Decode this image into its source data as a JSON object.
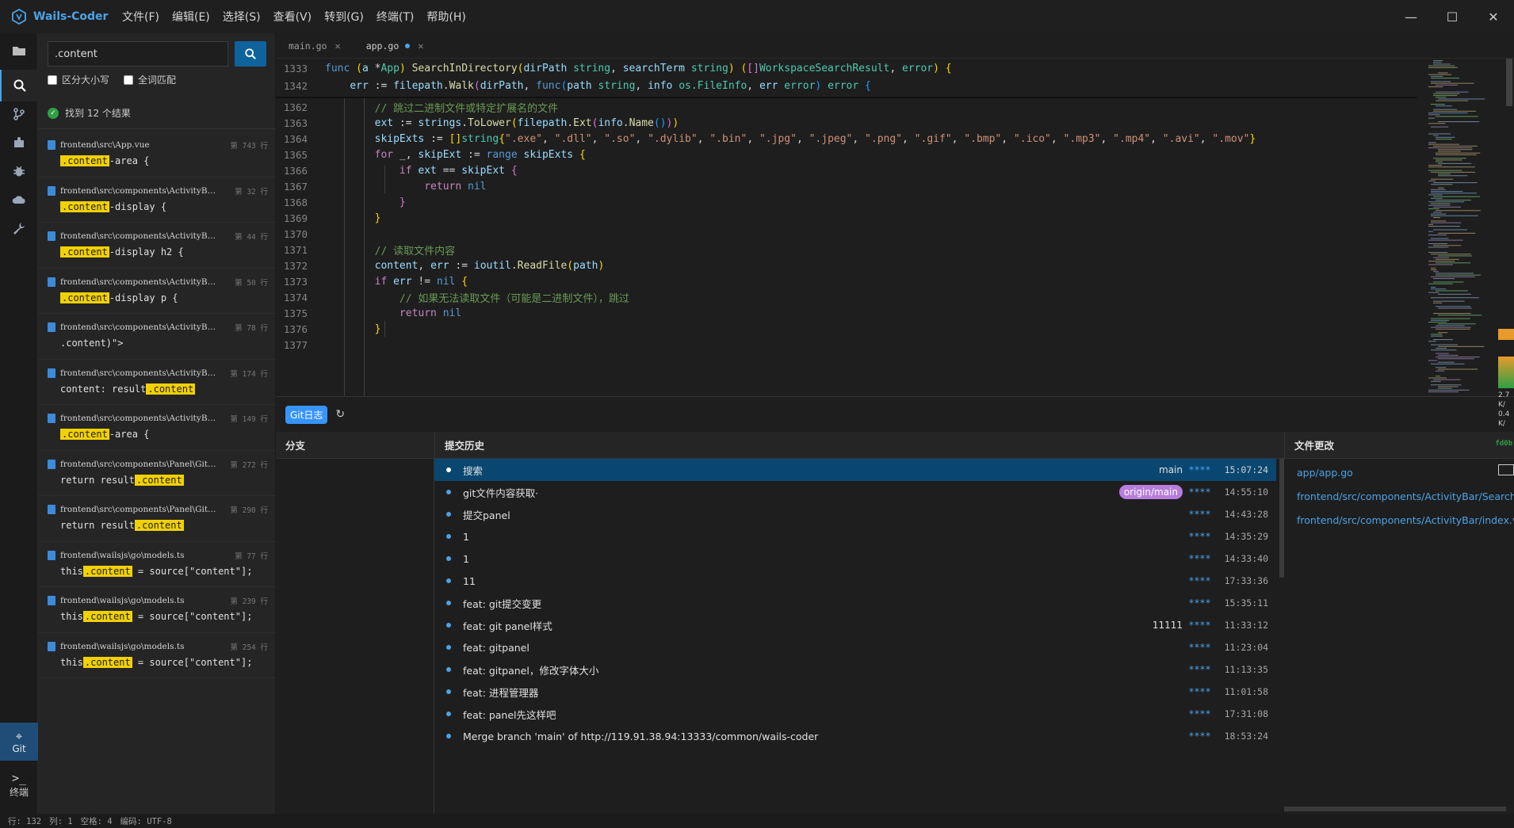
{
  "app": {
    "title": "Wails-Coder",
    "menus": [
      "文件(F)",
      "编辑(E)",
      "选择(S)",
      "查看(V)",
      "转到(G)",
      "终端(T)",
      "帮助(H)"
    ],
    "window_controls": [
      "—",
      "☐",
      "✕"
    ]
  },
  "activity": {
    "icons": [
      "folder-icon",
      "search-icon",
      "branch-icon",
      "puzzle-icon",
      "bug-icon",
      "cloud-icon",
      "wrench-icon"
    ],
    "git_label": "Git",
    "git_symbol": "⌖",
    "terminal_label": "终端",
    "terminal_symbol": ">_"
  },
  "search": {
    "value": ".content",
    "case_sensitive_label": "区分大小写",
    "whole_word_label": "全词匹配",
    "summary": "找到 12 个结果",
    "results": [
      {
        "path": "frontend\\src\\App.vue",
        "line": "第 743 行",
        "pre": "",
        "match": ".content",
        "post": "-area {"
      },
      {
        "path": "frontend\\src\\components\\ActivityBar\\…",
        "line": "第 32 行",
        "pre": "",
        "match": ".content",
        "post": "-display {"
      },
      {
        "path": "frontend\\src\\components\\ActivityBar\\…",
        "line": "第 44 行",
        "pre": "",
        "match": ".content",
        "post": "-display h2 {"
      },
      {
        "path": "frontend\\src\\components\\ActivityBar\\…",
        "line": "第 50 行",
        "pre": "",
        "match": ".content",
        "post": "-display p {"
      },
      {
        "path": "frontend\\src\\components\\ActivityBar\\…",
        "line": "第 78 行",
        "pre": ".content)\">",
        "match": "",
        "post": ""
      },
      {
        "path": "frontend\\src\\components\\ActivityBar\\…",
        "line": "第 174 行",
        "pre": "content: result",
        "match": ".content",
        "post": ""
      },
      {
        "path": "frontend\\src\\components\\ActivityBar\\…",
        "line": "第 149 行",
        "pre": "",
        "match": ".content",
        "post": "-area {"
      },
      {
        "path": "frontend\\src\\components\\Panel\\GitPanel…",
        "line": "第 272 行",
        "pre": "return result",
        "match": ".content",
        "post": ""
      },
      {
        "path": "frontend\\src\\components\\Panel\\GitPanel…",
        "line": "第 290 行",
        "pre": "return result",
        "match": ".content",
        "post": ""
      },
      {
        "path": "frontend\\wailsjs\\go\\models.ts",
        "line": "第 77 行",
        "pre": "this",
        "match": ".content",
        "post": " = source[\"content\"];"
      },
      {
        "path": "frontend\\wailsjs\\go\\models.ts",
        "line": "第 239 行",
        "pre": "this",
        "match": ".content",
        "post": " = source[\"content\"];"
      },
      {
        "path": "frontend\\wailsjs\\go\\models.ts",
        "line": "第 254 行",
        "pre": "this",
        "match": ".content",
        "post": " = source[\"content\"];"
      }
    ]
  },
  "editor": {
    "tabs": [
      {
        "label": "main.go",
        "modified": false
      },
      {
        "label": "app.go",
        "modified": true
      }
    ],
    "line_numbers": [
      "1333",
      "1342",
      "1362",
      "1363",
      "1364",
      "1365",
      "1366",
      "1367",
      "1368",
      "1369",
      "1370",
      "1371",
      "1372",
      "1373",
      "1374",
      "1375",
      "1376",
      "1377"
    ]
  },
  "git": {
    "panel_label": "Git日志",
    "refresh_icon": "↻",
    "branch_header": "分支",
    "commits_header": "提交历史",
    "files_header": "文件更改",
    "hash_hint": "fd0b",
    "commits": [
      {
        "message": "搜索",
        "ref": "main",
        "ref_pill": false,
        "author": "****",
        "time": "15:07:24"
      },
      {
        "message": "git文件内容获取·",
        "ref": "origin/main",
        "ref_pill": true,
        "author": "****",
        "time": "14:55:10"
      },
      {
        "message": "提交panel",
        "ref": "",
        "ref_pill": false,
        "author": "****",
        "time": "14:43:28"
      },
      {
        "message": "1",
        "ref": "",
        "ref_pill": false,
        "author": "****",
        "time": "14:35:29"
      },
      {
        "message": "1",
        "ref": "",
        "ref_pill": false,
        "author": "****",
        "time": "14:33:40"
      },
      {
        "message": "11",
        "ref": "",
        "ref_pill": false,
        "author": "****",
        "time": "17:33:36"
      },
      {
        "message": "feat: git提交变更",
        "ref": "",
        "ref_pill": false,
        "author": "****",
        "time": "15:35:11"
      },
      {
        "message": "feat: git panel样式",
        "ref": "11111",
        "ref_pill": false,
        "author": "****",
        "time": "11:33:12"
      },
      {
        "message": "feat: gitpanel",
        "ref": "",
        "ref_pill": false,
        "author": "****",
        "time": "11:23:04"
      },
      {
        "message": "feat: gitpanel，修改字体大小",
        "ref": "",
        "ref_pill": false,
        "author": "****",
        "time": "11:13:35"
      },
      {
        "message": "feat: 进程管理器",
        "ref": "",
        "ref_pill": false,
        "author": "****",
        "time": "11:01:58"
      },
      {
        "message": "feat: panel先这样吧",
        "ref": "",
        "ref_pill": false,
        "author": "****",
        "time": "17:31:08"
      },
      {
        "message": "Merge branch 'main' of http://119.91.38.94:13333/common/wails-coder",
        "ref": "",
        "ref_pill": false,
        "author": "****",
        "time": "18:53:24"
      }
    ],
    "files": [
      "app/app.go",
      "frontend/src/components/ActivityBar/SearchView.vue",
      "frontend/src/components/ActivityBar/index.vue"
    ]
  },
  "right_widgets": [
    "2.7",
    "K/",
    "0.4",
    "K/"
  ],
  "status": {
    "line": "行: 132",
    "col": "列: 1",
    "spaces": "空格: 4",
    "encoding": "编码: UTF-8"
  },
  "colors": {
    "accent": "#4aa3e8",
    "selection": "#094771",
    "highlight": "#f2d100"
  }
}
